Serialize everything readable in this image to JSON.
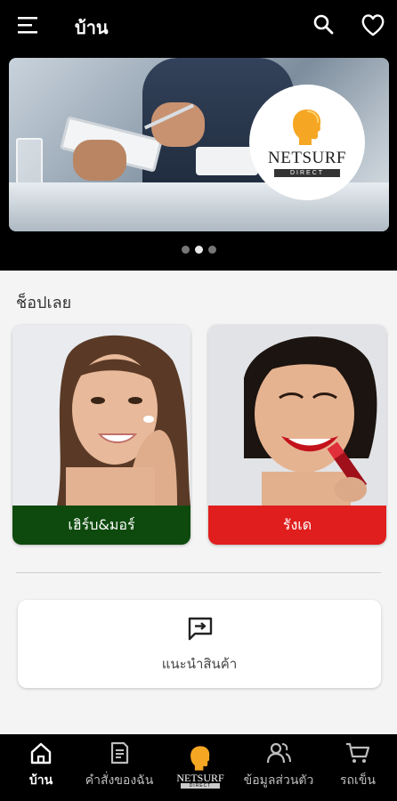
{
  "header": {
    "title": "บ้าน"
  },
  "banner": {
    "logo_text": "NETSURF",
    "logo_sub": "DIRECT",
    "slide_count": 3,
    "active_slide": 2
  },
  "shop": {
    "section_title": "ช็อปเลย",
    "cards": [
      {
        "label": "เฮิร์บ&มอร์",
        "color": "#0e4a0e"
      },
      {
        "label": "รังเด",
        "color": "#e01e1e"
      }
    ]
  },
  "recommend": {
    "label": "แนะนำสินค้า"
  },
  "bottom_nav": {
    "items": [
      {
        "label": "บ้าน",
        "icon": "home-icon",
        "active": true
      },
      {
        "label": "คำสั่งของฉัน",
        "icon": "orders-icon",
        "active": false
      },
      {
        "label": "NETSURF",
        "sub": "DIRECT",
        "icon": "netsurf-logo-icon",
        "active": false
      },
      {
        "label": "ข้อมูลส่วนตัว",
        "icon": "profile-icon",
        "active": false
      },
      {
        "label": "รถเข็น",
        "icon": "cart-icon",
        "active": false
      }
    ]
  },
  "colors": {
    "topbar_bg": "#000000",
    "herb_green": "#0e4a0e",
    "lipstick_red": "#e01e1e",
    "page_bg": "#f4f4f4"
  }
}
